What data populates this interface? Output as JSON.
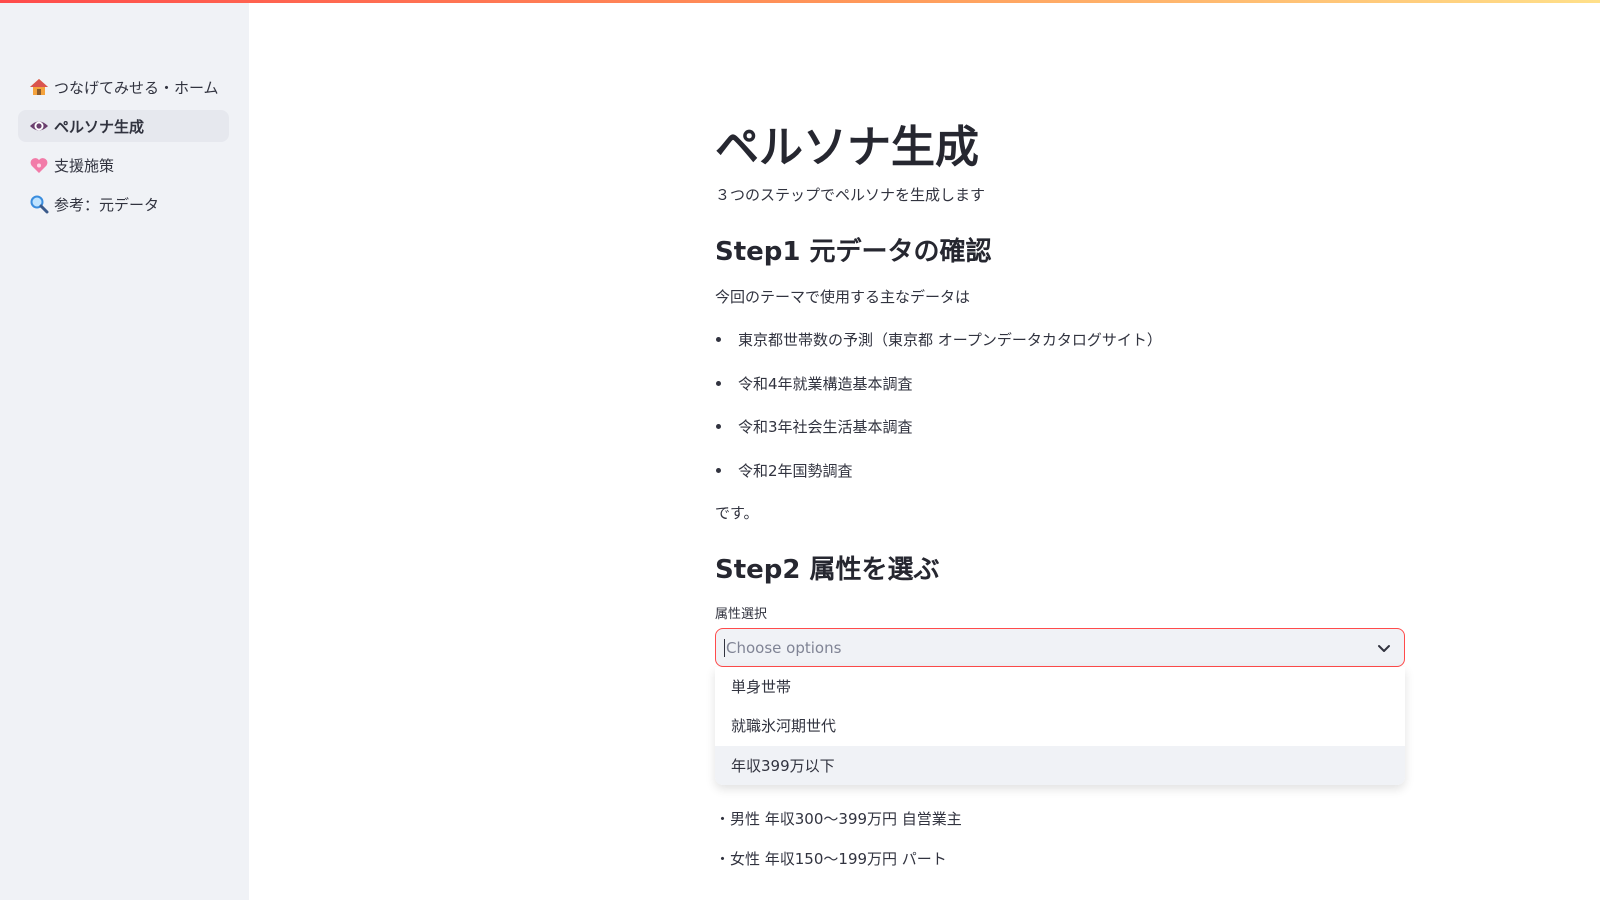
{
  "sidebar": {
    "items": [
      {
        "icon": "house-icon",
        "label": "つなげてみせる・ホーム",
        "active": false
      },
      {
        "icon": "eye-icon",
        "label": "ペルソナ生成",
        "active": true
      },
      {
        "icon": "heart-icon",
        "label": "支援施策",
        "active": false
      },
      {
        "icon": "magnifier-icon",
        "label": "参考：元データ",
        "active": false
      }
    ]
  },
  "main": {
    "title": "ペルソナ生成",
    "subtitle": "３つのステップでペルソナを生成します",
    "step1": {
      "heading": "Step1 元データの確認",
      "intro": "今回のテーマで使用する主なデータは",
      "items": [
        "東京都世帯数の予測（東京都 オープンデータカタログサイト）",
        "令和4年就業構造基本調査",
        "令和3年社会生活基本調査",
        "令和2年国勢調査"
      ],
      "outro": "です。"
    },
    "step2": {
      "heading": "Step2 属性を選ぶ",
      "select_label": "属性選択",
      "placeholder": "Choose options",
      "options": [
        "単身世帯",
        "就職氷河期世代",
        "年収399万以下"
      ],
      "highlighted_option": "年収399万以下"
    },
    "examples": [
      "・男性 年収300〜399万円 自営業主",
      "・女性 年収150〜199万円 パート"
    ]
  },
  "colors": {
    "accent": "#ff4b4b",
    "sidebar_bg": "#f0f2f6",
    "text": "#31333f"
  }
}
